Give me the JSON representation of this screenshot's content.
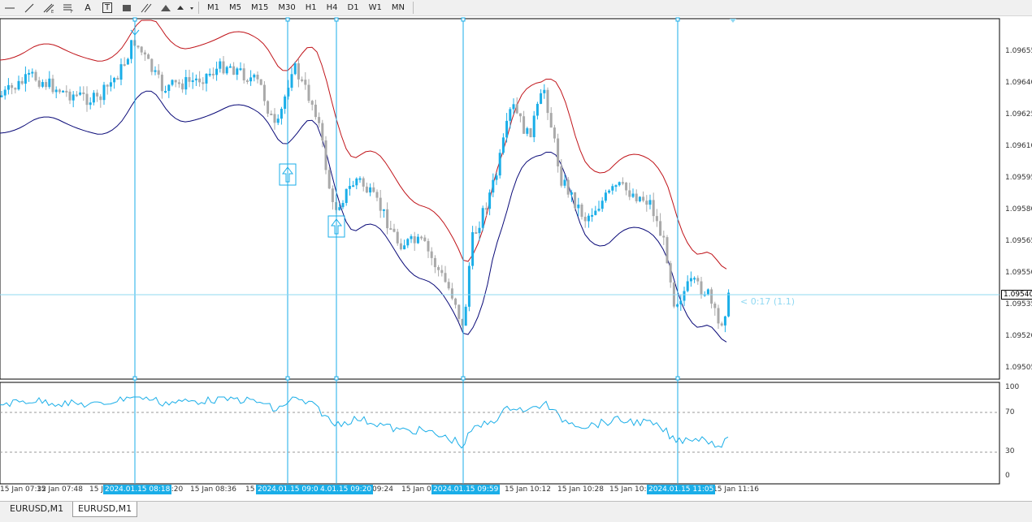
{
  "toolbar": {
    "timeframes": [
      "M1",
      "M5",
      "M15",
      "M30",
      "H1",
      "H4",
      "D1",
      "W1",
      "MN"
    ],
    "tool_icons": [
      "crosshair-icon",
      "trendline-icon",
      "fibonacci-icon",
      "gann-icon",
      "text-icon",
      "text-label-icon",
      "rectangle-icon",
      "channel-icon",
      "triangle-icon",
      "arrows-icon"
    ],
    "text_tool": "A",
    "text_label_tool": "T"
  },
  "price_axis": {
    "labels": [
      "1.09655",
      "1.09640",
      "1.09625",
      "1.09610",
      "1.09595",
      "1.09580",
      "1.09565",
      "1.09550",
      "1.09535",
      "1.09520",
      "1.09505"
    ],
    "current": "1.09540"
  },
  "timer_text": "< 0:17 (1.1)",
  "rsi_axis": {
    "labels": [
      "100",
      "70",
      "30",
      "0"
    ]
  },
  "time_axis": {
    "labels": [
      "15 Jan 07:32",
      "15 Jan 07:48",
      "15 J",
      "8:20",
      "15 Jan 08:36",
      "15",
      "09:24",
      "15 Jan 09",
      "15 Jan 10:12",
      "15 Jan 10:28",
      "15 Jan 10:4",
      "15 Jan 11:16"
    ],
    "tags": [
      "2024.01.15 08:18",
      "2024.01.15 09:05",
      "4.01.15 09:20",
      "2024.01.15 09:59",
      "2024.01.15 11:05"
    ]
  },
  "tabs": [
    "EURUSD,M1",
    "EURUSD,M1"
  ],
  "colors": {
    "bull": "#1aaee8",
    "bear": "#a9a9a9",
    "upper_band": "#c0141a",
    "lower_band": "#0a0a78",
    "vline": "#1aaee8",
    "rsi": "#1aaee8"
  }
}
